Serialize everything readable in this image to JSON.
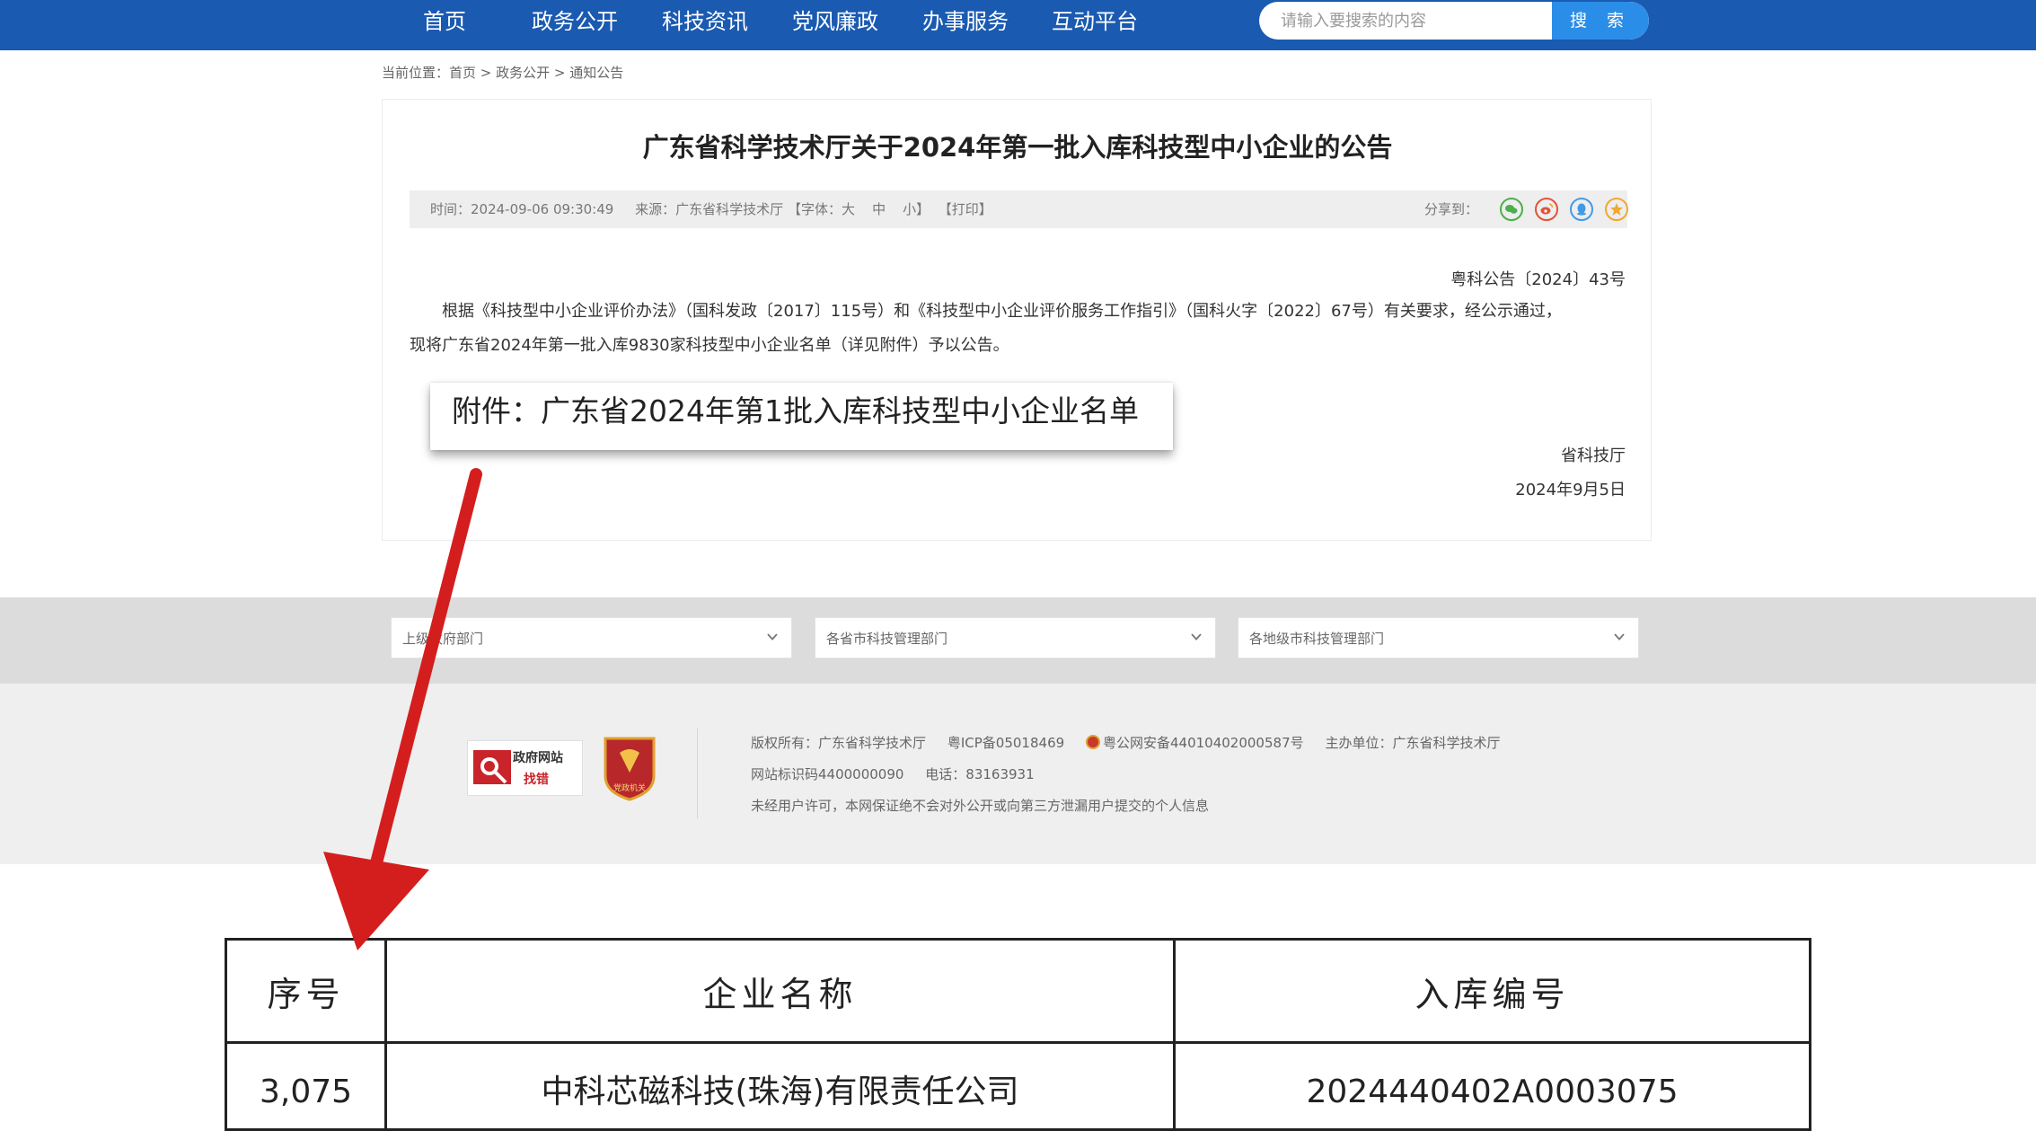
{
  "nav": {
    "items": [
      "首页",
      "政务公开",
      "科技资讯",
      "党风廉政",
      "办事服务",
      "互动平台"
    ],
    "search_placeholder": "请输入要搜索的内容",
    "search_button": "搜 索"
  },
  "breadcrumb": {
    "prefix": "当前位置：",
    "home": "首页",
    "sep1": " > ",
    "section": "政务公开",
    "sep2": " > ",
    "current": "通知公告"
  },
  "article": {
    "title": "广东省科学技术厅关于2024年第一批入库科技型中小企业的公告",
    "meta": {
      "time": "时间：2024-09-06 09:30:49",
      "source": "来源：广东省科学技术厅",
      "font_prefix": "【字体：",
      "font_large": "大",
      "font_medium": "中",
      "font_small": "小",
      "font_suffix": "】",
      "print": "【打印】",
      "share_label": "分享到："
    },
    "doc_number": "粤科公告〔2024〕43号",
    "paragraph_1": "根据《科技型中小企业评价办法》（国科发政〔2017〕115号）和《科技型中小企业评价服务工作指引》（国科火字〔2022〕67号）有关要求，经公示通过，",
    "paragraph_2": "现将广东省2024年第一批入库9830家科技型中小企业名单（详见附件）予以公告。",
    "signer": "省科技厅",
    "date": "2024年9月5日"
  },
  "attachment": {
    "label": "附件：广东省2024年第1批入库科技型中小企业名单"
  },
  "links": {
    "dropdowns": [
      "上级政府部门",
      "各省市科技管理部门",
      "各地级市科技管理部门"
    ]
  },
  "footer": {
    "gov_badge_line1": "政府网站",
    "gov_badge_line2": "找错",
    "party_badge_text": "党政机关",
    "line1_copyright": "版权所有：广东省科学技术厅",
    "line1_icp": "粤ICP备05018469",
    "line1_police": "粤公网安备44010402000587号",
    "line1_sponsor": "主办单位：广东省科学技术厅",
    "line2_site_id": "网站标识码4400000090",
    "line2_phone": "电话：83163931",
    "line3": "未经用户许可，本网保证绝不会对外公开或向第三方泄漏用户提交的个人信息"
  },
  "table": {
    "headers": [
      "序号",
      "企业名称",
      "入库编号"
    ],
    "rows": [
      [
        "3,075",
        "中科芯磁科技(珠海)有限责任公司",
        "2024440402A0003075"
      ]
    ]
  },
  "colors": {
    "nav_bg": "#1a5ab1",
    "search_button": "#2a8de7",
    "arrow": "#d41e1e",
    "links_bar": "#dcdcdc",
    "footer_bg": "#efefef"
  }
}
